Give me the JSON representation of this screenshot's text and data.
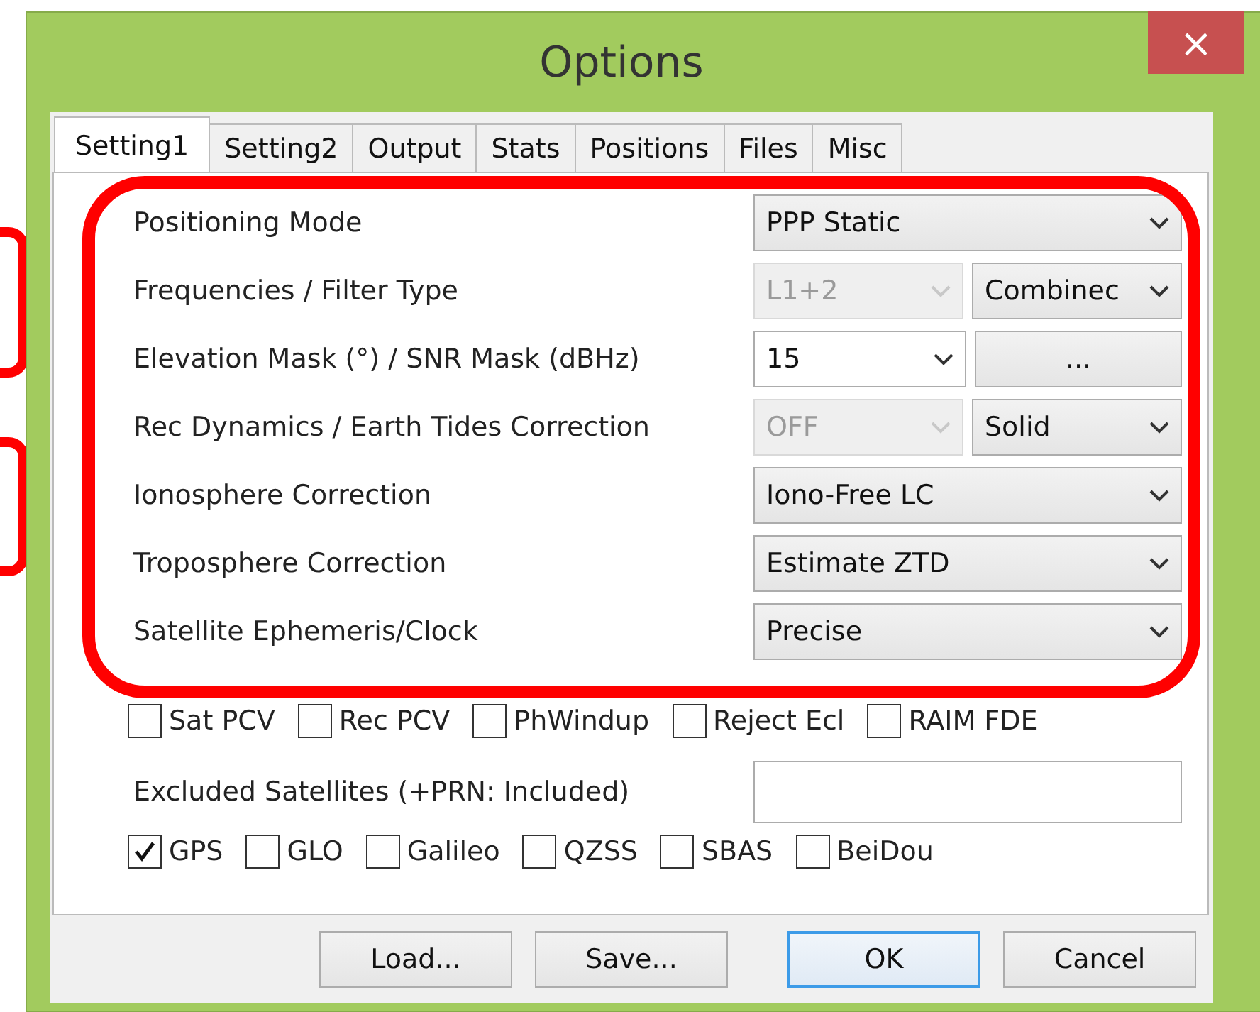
{
  "window": {
    "title": "Options",
    "close": "×"
  },
  "tabs": [
    {
      "label": "Setting1",
      "selected": true
    },
    {
      "label": "Setting2",
      "selected": false
    },
    {
      "label": "Output",
      "selected": false
    },
    {
      "label": "Stats",
      "selected": false
    },
    {
      "label": "Positions",
      "selected": false
    },
    {
      "label": "Files",
      "selected": false
    },
    {
      "label": "Misc",
      "selected": false
    }
  ],
  "rows": [
    {
      "label": "Positioning Mode",
      "controls": [
        {
          "kind": "select",
          "value": "PPP Static",
          "disabled": false
        }
      ]
    },
    {
      "label": "Frequencies / Filter Type",
      "controls": [
        {
          "kind": "select",
          "value": "L1+2",
          "disabled": true
        },
        {
          "kind": "select",
          "value": "Combinec",
          "disabled": false
        }
      ]
    },
    {
      "label": "Elevation Mask (°) / SNR Mask (dBHz)",
      "controls": [
        {
          "kind": "combo",
          "value": "15",
          "disabled": false
        },
        {
          "kind": "button",
          "value": "...",
          "disabled": false
        }
      ]
    },
    {
      "label": "Rec Dynamics / Earth Tides Correction",
      "controls": [
        {
          "kind": "select",
          "value": "OFF",
          "disabled": true
        },
        {
          "kind": "select",
          "value": "Solid",
          "disabled": false
        }
      ]
    },
    {
      "label": "Ionosphere Correction",
      "controls": [
        {
          "kind": "select",
          "value": "Iono-Free LC",
          "disabled": false
        }
      ]
    },
    {
      "label": "Troposphere Correction",
      "controls": [
        {
          "kind": "select",
          "value": "Estimate ZTD",
          "disabled": false
        }
      ]
    },
    {
      "label": "Satellite Ephemeris/Clock",
      "controls": [
        {
          "kind": "select",
          "value": "Precise",
          "disabled": false
        }
      ]
    }
  ],
  "corrections": [
    {
      "label": "Sat PCV",
      "checked": false
    },
    {
      "label": "Rec PCV",
      "checked": false
    },
    {
      "label": "PhWindup",
      "checked": false
    },
    {
      "label": "Reject Ecl",
      "checked": false
    },
    {
      "label": "RAIM FDE",
      "checked": false
    }
  ],
  "excluded_satellites": {
    "label": "Excluded Satellites (+PRN: Included)"
  },
  "systems": [
    {
      "label": "GPS",
      "checked": true
    },
    {
      "label": "GLO",
      "checked": false
    },
    {
      "label": "Galileo",
      "checked": false
    },
    {
      "label": "QZSS",
      "checked": false
    },
    {
      "label": "SBAS",
      "checked": false
    },
    {
      "label": "BeiDou",
      "checked": false
    }
  ],
  "buttons": [
    {
      "label": "Load...",
      "default": false
    },
    {
      "label": "Save...",
      "default": false
    },
    {
      "label": "OK",
      "default": true
    },
    {
      "label": "Cancel",
      "default": false
    }
  ]
}
